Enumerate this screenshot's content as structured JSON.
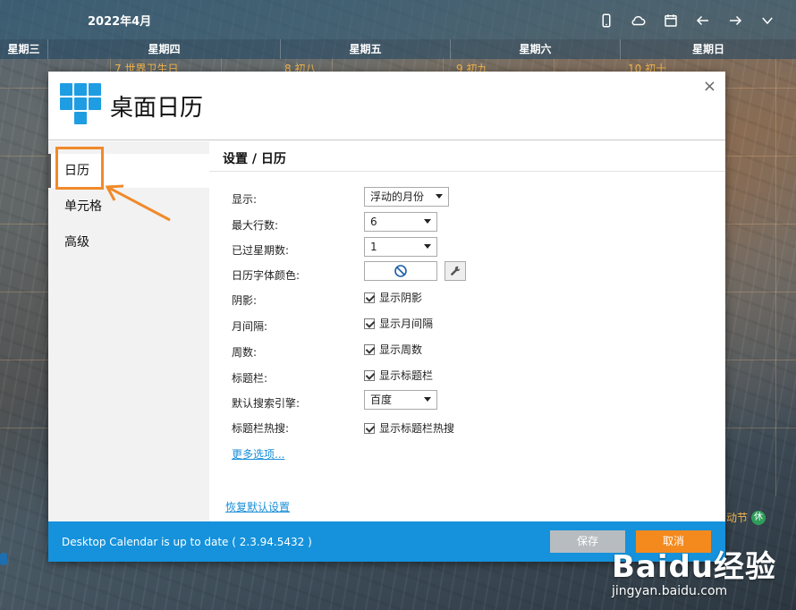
{
  "calendar": {
    "month": "2022年4月",
    "weekdays": [
      "星期三",
      "星期四",
      "星期五",
      "星期六",
      "星期日"
    ],
    "days": [
      {
        "num": "7",
        "label": "世界卫生日"
      },
      {
        "num": "8",
        "label": "初八"
      },
      {
        "num": "9",
        "label": "初九"
      },
      {
        "num": "10",
        "label": "初十"
      }
    ],
    "holiday_text": "动节",
    "holiday_badge": "休",
    "icons": [
      "phone-icon",
      "cloud-icon",
      "calendar-icon",
      "arrow-left-icon",
      "arrow-right-icon",
      "chevron-down-icon"
    ]
  },
  "dialog": {
    "title": "桌面日历",
    "close": "×",
    "sidebar": {
      "items": [
        {
          "label": "日历",
          "active": true
        },
        {
          "label": "单元格",
          "active": false
        },
        {
          "label": "高级",
          "active": false
        }
      ]
    },
    "content_title": "设置 / 日历",
    "settings": {
      "display_label": "显示:",
      "display_value": "浮动的月份",
      "max_rows_label": "最大行数:",
      "max_rows_value": "6",
      "past_weeks_label": "已过星期数:",
      "past_weeks_value": "1",
      "font_color_label": "日历字体颜色:",
      "shadow_label": "阴影:",
      "shadow_check": "显示阴影",
      "month_gap_label": "月间隔:",
      "month_gap_check": "显示月间隔",
      "week_num_label": "周数:",
      "week_num_check": "显示周数",
      "titlebar_label": "标题栏:",
      "titlebar_check": "显示标题栏",
      "search_engine_label": "默认搜索引擎:",
      "search_engine_value": "百度",
      "hot_search_label": "标题栏热搜:",
      "hot_search_check": "显示标题栏热搜"
    },
    "more_options": "更多选项...",
    "restore_defaults": "恢复默认设置",
    "footer": {
      "status": "Desktop Calendar is up to date ( 2.3.94.5432 )",
      "save": "保存",
      "cancel": "取消"
    }
  },
  "watermark": {
    "logo": "Baidu经验",
    "url": "jingyan.baidu.com"
  },
  "colors": {
    "accent": "#1592db",
    "highlight": "#f08a2a",
    "cancel": "#f48a1e",
    "save_disabled": "#b7bcc0",
    "day_text": "#f7b84a"
  }
}
